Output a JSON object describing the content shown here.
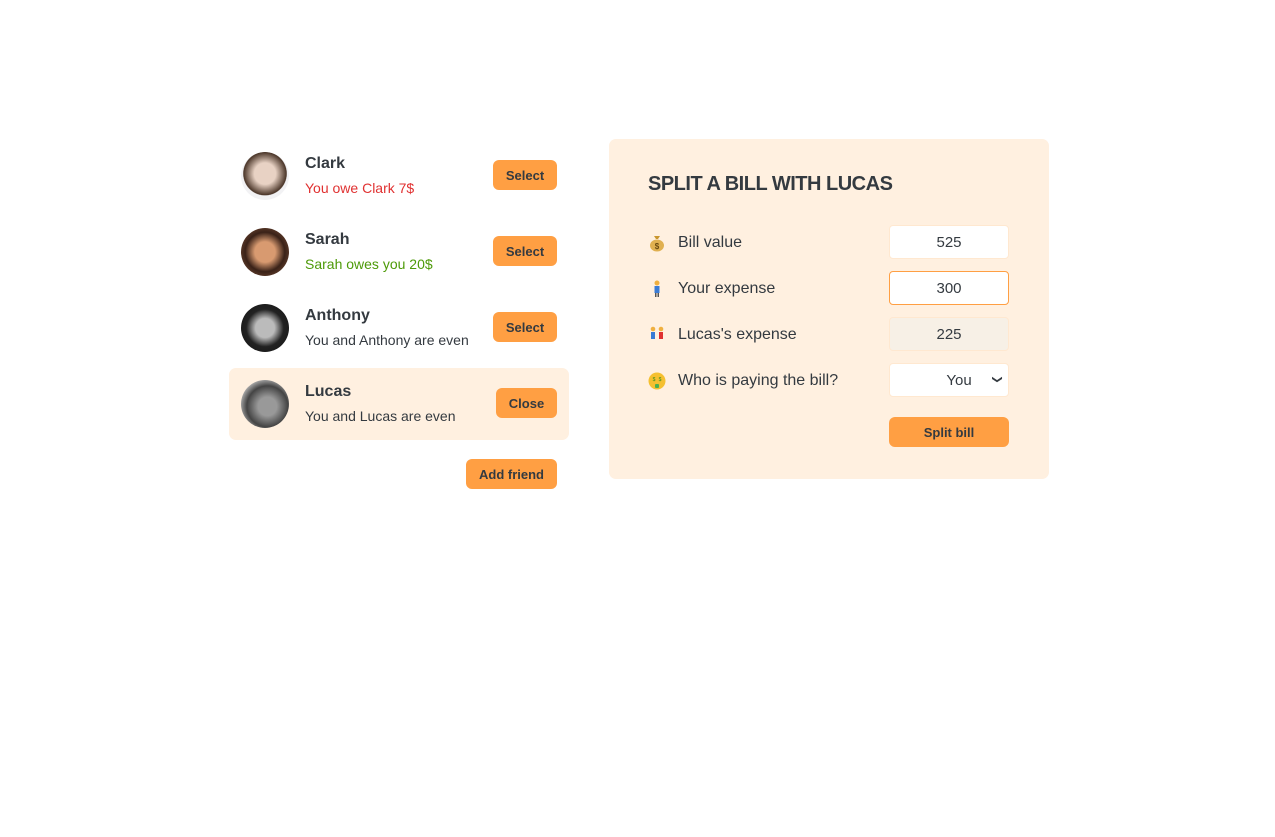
{
  "friends": [
    {
      "name": "Clark",
      "status": "You owe Clark 7$",
      "status_color": "red",
      "button": "Select",
      "selected": false
    },
    {
      "name": "Sarah",
      "status": "Sarah owes you 20$",
      "status_color": "green",
      "button": "Select",
      "selected": false
    },
    {
      "name": "Anthony",
      "status": "You and Anthony are even",
      "status_color": "neutral",
      "button": "Select",
      "selected": false
    },
    {
      "name": "Lucas",
      "status": "You and Lucas are even",
      "status_color": "neutral",
      "button": "Close",
      "selected": true
    }
  ],
  "add_friend_label": "Add friend",
  "form": {
    "title": "SPLIT A BILL WITH LUCAS",
    "bill_label": "Bill value",
    "bill_value": "525",
    "bill_icon": "money-bag",
    "your_label": "Your expense",
    "your_value": "300",
    "your_icon": "person",
    "friend_label": "Lucas's expense",
    "friend_value": "225",
    "friend_icon": "two-people",
    "payer_label": "Who is paying the bill?",
    "payer_value": "You",
    "payer_icon": "money-mouth-face",
    "submit_label": "Split bill"
  },
  "colors": {
    "accent": "#ff9f43",
    "panel": "#fff0e0",
    "red": "#e03131",
    "green": "#4d9a08"
  }
}
